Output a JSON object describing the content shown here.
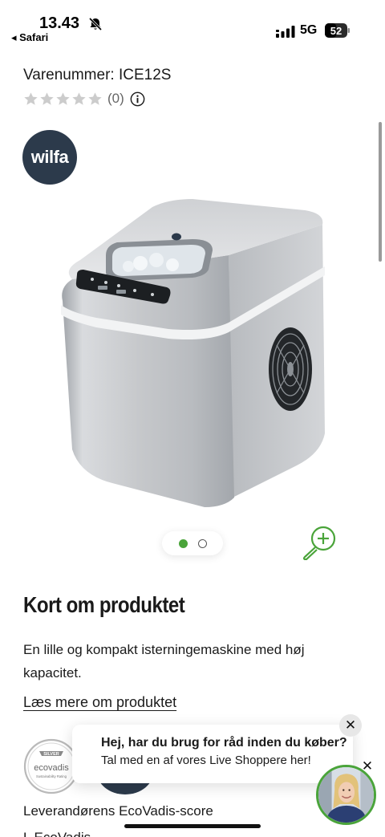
{
  "status_bar": {
    "time": "13.43",
    "back_app": "◂ Safari",
    "network": "5G",
    "battery": "52"
  },
  "product": {
    "sku_label": "Varenummer: ICE12S",
    "rating_count": "(0)",
    "star_count": 5,
    "rating_value": 0,
    "brand_logo": "wilfa",
    "image_icon": "ice-maker-product-image",
    "carousel": {
      "total": 2,
      "active_index": 0
    }
  },
  "about": {
    "title": "Kort om produktet",
    "description": "En lille og kompakt isterningemaskine med høj kapacitet.",
    "read_more": "Læs mere om produktet"
  },
  "ecovadis": {
    "badge_level": "SILVER",
    "badge_brand": "ecovadis",
    "badge_caption": "Sustainability Rating",
    "label": "Leverandørens EcoVadis-score",
    "cutoff_text": "L                  EcoVadis"
  },
  "chat": {
    "line1": "Hej, har du brug for råd inden du køber?",
    "line2": "Tal med en af vores Live Shoppere her!",
    "close_glyph": "✕"
  },
  "colors": {
    "accent_green": "#4aa43a",
    "brand_navy": "#2c3a4b",
    "star_gray": "#cccccc"
  }
}
